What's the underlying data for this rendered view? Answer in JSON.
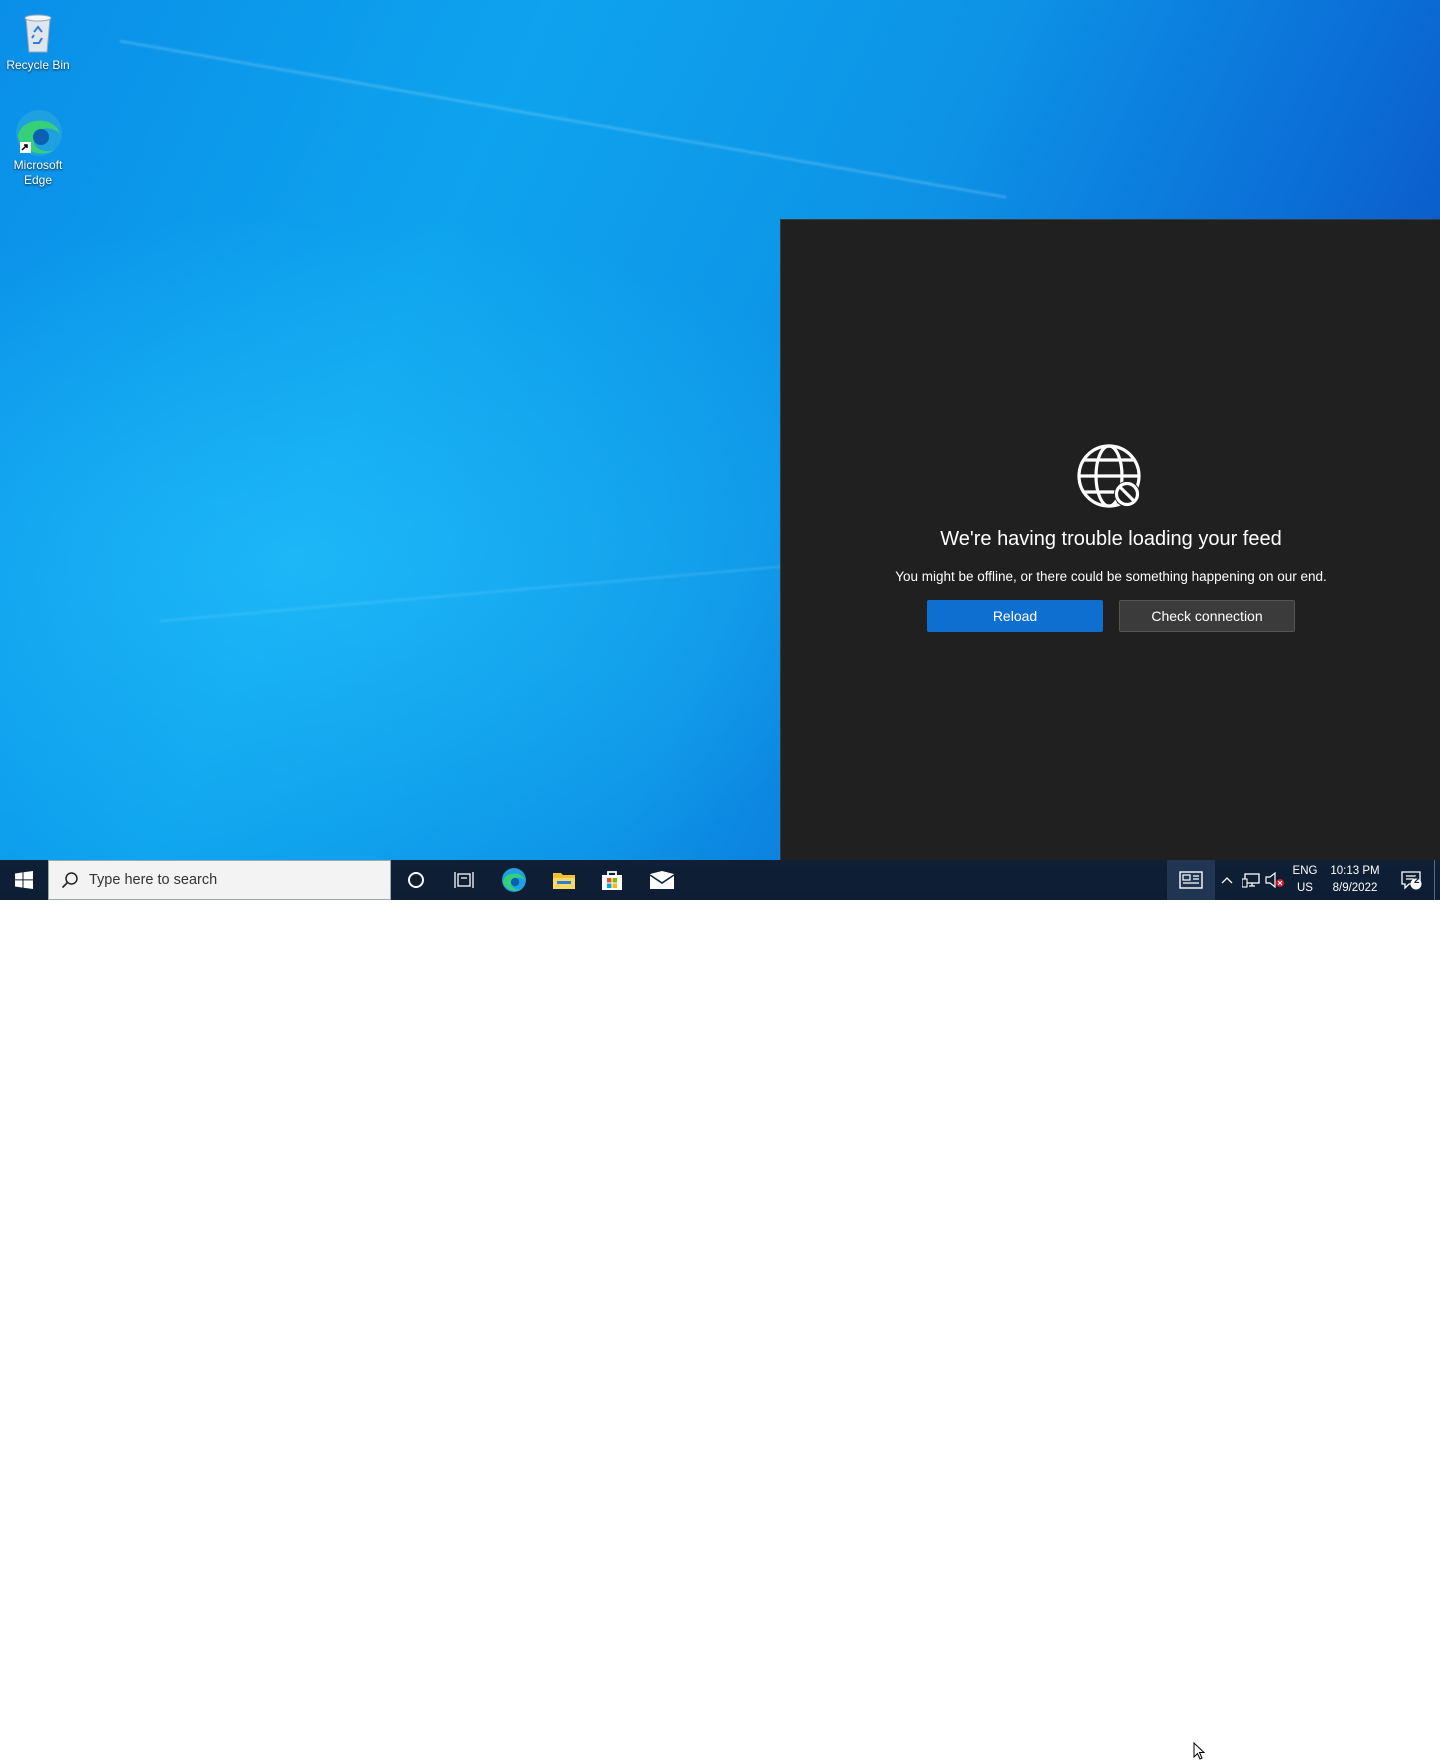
{
  "desktop": {
    "icons": [
      {
        "label": "Recycle Bin",
        "icon": "recycle-bin-icon"
      },
      {
        "label": "Microsoft\nEdge",
        "icon": "edge-icon"
      }
    ]
  },
  "feed": {
    "icon": "globe-blocked-icon",
    "title": "We're having trouble loading your feed",
    "message": "You might be offline, or there could be something happening on our end.",
    "reload_label": "Reload",
    "check_label": "Check connection",
    "colors": {
      "panel": "#202020",
      "primary": "#0f6fd0",
      "secondary": "#3b3b3b"
    }
  },
  "taskbar": {
    "search_placeholder": "Type here to search",
    "apps": [
      "cortana-icon",
      "task-view-icon",
      "edge-icon",
      "file-explorer-icon",
      "store-icon",
      "mail-icon"
    ],
    "lang_top": "ENG",
    "lang_bottom": "US",
    "time": "10:13 PM",
    "date": "8/9/2022",
    "notification_count": "2"
  }
}
